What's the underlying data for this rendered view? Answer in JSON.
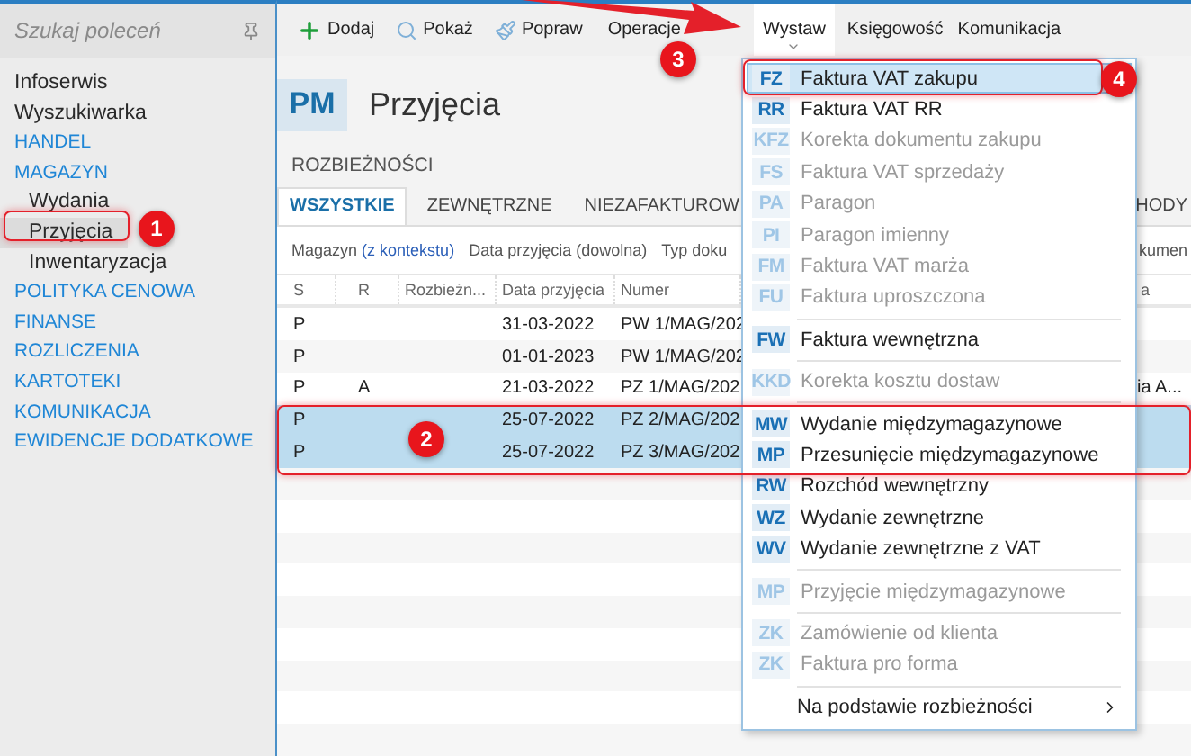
{
  "sidebar": {
    "search": {
      "placeholder": "Szukaj poleceń"
    },
    "items": [
      {
        "label": "Infoserwis",
        "kind": "command",
        "selected": false
      },
      {
        "label": "Wyszukiwarka",
        "kind": "command",
        "selected": false
      },
      {
        "label": "HANDEL",
        "kind": "module",
        "selected": false
      },
      {
        "label": "MAGAZYN",
        "kind": "module",
        "selected": false,
        "children": [
          {
            "label": "Wydania",
            "kind": "command",
            "selected": false
          },
          {
            "label": "Przyjęcia",
            "kind": "command",
            "selected": true
          },
          {
            "label": "Inwentaryzacja",
            "kind": "command",
            "selected": false
          }
        ]
      },
      {
        "label": "POLITYKA CENOWA",
        "kind": "module",
        "selected": false
      },
      {
        "label": "FINANSE",
        "kind": "module",
        "selected": false
      },
      {
        "label": "ROZLICZENIA",
        "kind": "module",
        "selected": false
      },
      {
        "label": "KARTOTEKI",
        "kind": "module",
        "selected": false
      },
      {
        "label": "KOMUNIKACJA",
        "kind": "module",
        "selected": false
      },
      {
        "label": "EWIDENCJE DODATKOWE",
        "kind": "module",
        "selected": false
      }
    ]
  },
  "toolbar": [
    {
      "label": "Dodaj",
      "selected": false
    },
    {
      "label": "Pokaż",
      "selected": false
    },
    {
      "label": "Popraw",
      "selected": false
    },
    {
      "label": "Operacje",
      "selected": false
    },
    {
      "label": "Wystaw",
      "selected": true
    },
    {
      "label": "Księgowość",
      "selected": false
    },
    {
      "label": "Komunikacja",
      "selected": false
    }
  ],
  "header": {
    "code": "PM",
    "title": "Przyjęcia"
  },
  "section_label": "ROZBIEŻNOŚCI",
  "tabs": [
    {
      "label": "WSZYSTKIE",
      "selected": true
    },
    {
      "label": "ZEWNĘTRZNE",
      "selected": false
    },
    {
      "label": "NIEZAFAKTUROW",
      "selected": false
    },
    {
      "label": "HODY",
      "selected": false
    }
  ],
  "filters": [
    {
      "label": "Magazyn",
      "link": "(z kontekstu)"
    },
    {
      "label": "Data przyjęcia (dowolna)"
    },
    {
      "label": "Typ doku"
    },
    {
      "label": "kumen"
    }
  ],
  "table": {
    "columns": [
      "S",
      "R",
      "Rozbieżn...",
      "Data przyjęcia",
      "Numer",
      "a"
    ],
    "rows": [
      {
        "cells": [
          "P",
          "",
          "",
          "31-03-2022",
          "PW 1/MAG/202",
          ""
        ],
        "selected": false
      },
      {
        "cells": [
          "P",
          "",
          "",
          "01-01-2023",
          "PW 1/MAG/202",
          ""
        ],
        "selected": false
      },
      {
        "cells": [
          "P",
          "A",
          "",
          "21-03-2022",
          "PZ 1/MAG/202",
          "ia A..."
        ],
        "selected": false
      },
      {
        "cells": [
          "P",
          "",
          "",
          "25-07-2022",
          "PZ 2/MAG/202",
          ""
        ],
        "selected": true
      },
      {
        "cells": [
          "P",
          "",
          "",
          "25-07-2022",
          "PZ 3/MAG/202",
          ""
        ],
        "selected": true
      }
    ]
  },
  "menu": [
    {
      "kind": "item",
      "code": "FZ",
      "label": "Faktura VAT zakupu",
      "disabled": false,
      "selected": true
    },
    {
      "kind": "item",
      "code": "RR",
      "label": "Faktura VAT RR",
      "disabled": false,
      "selected": false
    },
    {
      "kind": "item",
      "code": "KFZ",
      "label": "Korekta dokumentu zakupu",
      "disabled": true,
      "selected": false
    },
    {
      "kind": "item",
      "code": "FS",
      "label": "Faktura VAT sprzedaży",
      "disabled": true,
      "selected": false
    },
    {
      "kind": "item",
      "code": "PA",
      "label": "Paragon",
      "disabled": true,
      "selected": false
    },
    {
      "kind": "item",
      "code": "PI",
      "label": "Paragon imienny",
      "disabled": true,
      "selected": false
    },
    {
      "kind": "item",
      "code": "FM",
      "label": "Faktura VAT marża",
      "disabled": true,
      "selected": false
    },
    {
      "kind": "item",
      "code": "FU",
      "label": "Faktura uproszczona",
      "disabled": true,
      "selected": false
    },
    {
      "kind": "separator"
    },
    {
      "kind": "item",
      "code": "FW",
      "label": "Faktura wewnętrzna",
      "disabled": false,
      "selected": false
    },
    {
      "kind": "separator"
    },
    {
      "kind": "item",
      "code": "KKD",
      "label": "Korekta kosztu dostaw",
      "disabled": true,
      "selected": false
    },
    {
      "kind": "separator"
    },
    {
      "kind": "item",
      "code": "MW",
      "label": "Wydanie międzymagazynowe",
      "disabled": false,
      "selected": false
    },
    {
      "kind": "item",
      "code": "MP",
      "label": "Przesunięcie międzymagazynowe",
      "disabled": false,
      "selected": false
    },
    {
      "kind": "item",
      "code": "RW",
      "label": "Rozchód wewnętrzny",
      "disabled": false,
      "selected": false
    },
    {
      "kind": "item",
      "code": "WZ",
      "label": "Wydanie zewnętrzne",
      "disabled": false,
      "selected": false
    },
    {
      "kind": "item",
      "code": "WV",
      "label": "Wydanie zewnętrzne z VAT",
      "disabled": false,
      "selected": false
    },
    {
      "kind": "separator"
    },
    {
      "kind": "item",
      "code": "MP",
      "label": "Przyjęcie międzymagazynowe",
      "disabled": true,
      "selected": false
    },
    {
      "kind": "separator"
    },
    {
      "kind": "item",
      "code": "ZK",
      "label": "Zamówienie od klienta",
      "disabled": true,
      "selected": false
    },
    {
      "kind": "item",
      "code": "ZK",
      "label": "Faktura pro forma",
      "disabled": true,
      "selected": false
    },
    {
      "kind": "separator"
    },
    {
      "kind": "submenu",
      "label": "Na podstawie rozbieżności",
      "disabled": false,
      "selected": false
    }
  ],
  "annotations": [
    "1",
    "2",
    "3",
    "4"
  ]
}
